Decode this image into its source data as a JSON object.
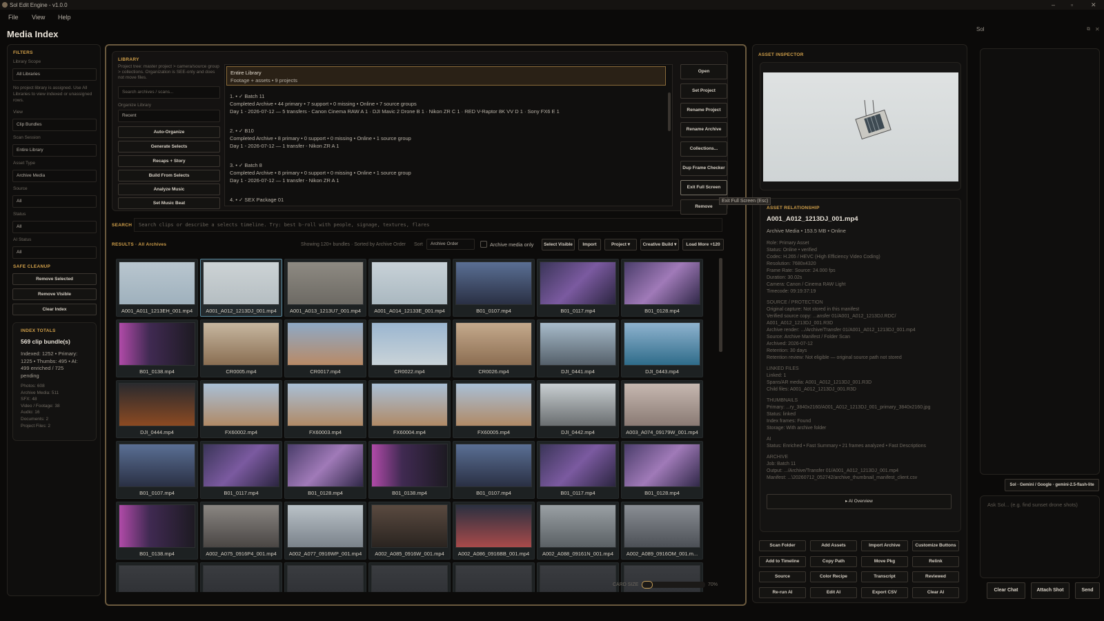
{
  "window": {
    "title": "Sol Edit Engine - v1.0.0"
  },
  "menu": [
    "File",
    "View",
    "Help"
  ],
  "page_title": "Media Index",
  "filters": {
    "header": "FILTERS",
    "library_scope_label": "Library Scope",
    "library_scope_value": "All Libraries",
    "note": "No project library is assigned. Use All Libraries to view indexed or unassigned rows.",
    "view_label": "View",
    "view_value": "Clip Bundles",
    "scan_label": "Scan Session",
    "scan_value": "Entire Library",
    "asset_label": "Asset Type",
    "asset_value": "Archive Media",
    "source_label": "Source",
    "source_value": "All",
    "status_label": "Status",
    "status_value": "All",
    "ai_label": "AI Status",
    "ai_value": "All"
  },
  "cleanup": {
    "header": "SAFE CLEANUP",
    "remove_selected": "Remove Selected",
    "remove_visible": "Remove Visible",
    "clear_index": "Clear Index"
  },
  "totals": {
    "header": "INDEX TOTALS",
    "count": "569 clip bundle(s)",
    "summary": [
      "Indexed: 1252 • Primary:",
      "1225 • Thumbs: 495 • AI:",
      "499 enriched / 725",
      "pending"
    ],
    "lines": [
      "Photos: 608",
      "Archive Media: 511",
      "SFX: 48",
      "Video / Footage: 38",
      "Audio: 16",
      "Documents: 2",
      "Project Files: 2"
    ]
  },
  "library": {
    "header": "LIBRARY",
    "desc": "Project tree: master project > camera/source group > collections. Organization is SEE-only and does not move files.",
    "search_placeholder": "Search archives / scans...",
    "organize_label": "Organize Library",
    "organize_value": "Recent",
    "actions": [
      "Auto-Organize",
      "Generate Selects",
      "Recaps + Story",
      "Build From Selects",
      "Analyze Music",
      "Set Music Beat"
    ],
    "entire": {
      "title": "Entire Library",
      "sub": "Footage + assets • 9 projects"
    },
    "items": [
      {
        "t": "1. • ✓ Batch 11",
        "a": "Completed Archive • 44 primary • 7 support • 0 missing • Online • 7 source groups",
        "b": "Day 1 - 2026-07-12 — 5 transfers - Canon Cinema RAW A 1 · DJI Mavic 2 Drone B 1 · Nikon ZR C 1 · RED V-Raptor 8K VV D 1 · Sony FX6 E 1"
      },
      {
        "t": "2. • ✓ B10",
        "a": "Completed Archive • 8 primary • 0 support • 0 missing • Online • 1 source group",
        "b": "Day 1 - 2026-07-12 — 1 transfer - Nikon ZR A 1"
      },
      {
        "t": "3. • ✓ Batch 8",
        "a": "Completed Archive • 8 primary • 0 support • 0 missing • Online • 1 source group",
        "b": "Day 1 - 2026-07-12 — 1 transfer - Nikon ZR A 1"
      },
      {
        "t": "4. • ✓ SEX Package 01",
        "a": "",
        "b": ""
      }
    ],
    "side": [
      "Open",
      "Set Project",
      "Rename Project",
      "Rename Archive",
      "Collections...",
      "Dup Frame Checker",
      "Exit Full Screen",
      "Remove"
    ],
    "tooltip": "Exit Full Screen (Esc)"
  },
  "search": {
    "label": "SEARCH",
    "placeholder": "Search clips or describe a selects timeline. Try: best b-roll with people, signage, textures, flares"
  },
  "results": {
    "label": "RESULTS · All Archives",
    "info": "Showing 120+ bundles · Sorted by Archive Order",
    "sort_label": "Sort",
    "sort_value": "Archive Order",
    "archive_only": "Archive media only",
    "buttons": [
      "Select Visible",
      "Import",
      "Project ▾",
      "Creative Build ▾",
      "Load More +120"
    ]
  },
  "grid": [
    "A001_A011_1213EH_001.mp4",
    "A001_A012_1213DJ_001.mp4",
    "A001_A013_1213U7_001.mp4",
    "A001_A014_12133E_001.mp4",
    "B01_0107.mp4",
    "B01_0117.mp4",
    "B01_0128.mp4",
    "B01_0138.mp4",
    "CR0005.mp4",
    "CR0017.mp4",
    "CR0022.mp4",
    "CR0026.mp4",
    "DJI_0441.mp4",
    "DJI_0443.mp4",
    "DJI_0444.mp4",
    "FX60002.mp4",
    "FX60003.mp4",
    "FX60004.mp4",
    "FX60005.mp4",
    "DJI_0442.mp4",
    "A003_A074_09179W_001.mp4",
    "B01_0107.mp4",
    "B01_0117.mp4",
    "B01_0128.mp4",
    "B01_0138.mp4",
    "B01_0107.mp4",
    "B01_0117.mp4",
    "B01_0128.mp4",
    "B01_0138.mp4",
    "A002_A075_0916P4_001.mp4",
    "A002_A077_0916WP_001.mp4",
    "A002_A085_0916W_001.mp4",
    "A002_A086_0916BB_001.mp4",
    "A002_A088_09161N_001.mp4",
    "A002_A089_0916OM_001.m..."
  ],
  "card_size": {
    "label": "CARD SIZE",
    "value": "70%",
    "level": 0.7
  },
  "inspector": {
    "header": "ASSET INSPECTOR",
    "rel_header": "ASSET RELATIONSHIP",
    "file": "A001_A012_1213DJ_001.mp4",
    "meta": "Archive Media • 153.5 MB • Online",
    "lines": [
      {
        "h": false,
        "t": "Role: Primary Asset"
      },
      {
        "h": false,
        "t": "Status: Online • verified"
      },
      {
        "h": false,
        "t": "Codec: H.265 / HEVC (High Efficiency Video Coding)"
      },
      {
        "h": false,
        "t": "Resolution: 7680x4320"
      },
      {
        "h": false,
        "t": "Frame Rate: Source: 24.000 fps"
      },
      {
        "h": false,
        "t": "Duration: 30.02s"
      },
      {
        "h": false,
        "t": "Camera: Canon / Cinema RAW Light"
      },
      {
        "h": false,
        "t": "Timecode: 09:19:37:19"
      },
      {
        "h": true,
        "t": "SOURCE / PROTECTION"
      },
      {
        "h": false,
        "t": "Original capture: Not stored in this manifest"
      },
      {
        "h": false,
        "t": "Verified source copy: ...ansfer 01/A001_A012_1213DJ.RDC/"
      },
      {
        "h": false,
        "t": "A001_A012_1213DJ_001.R3D"
      },
      {
        "h": false,
        "t": "Archive render: .../Archive/Transfer 01/A001_A012_1213DJ_001.mp4"
      },
      {
        "h": false,
        "t": "Source: Archive Manifest / Folder Scan"
      },
      {
        "h": false,
        "t": "Archived: 2026-07-12"
      },
      {
        "h": false,
        "t": "Retention: 30 days"
      },
      {
        "h": false,
        "t": "Retention review: Not eligible — original source path not stored"
      },
      {
        "h": true,
        "t": "LINKED FILES"
      },
      {
        "h": false,
        "t": "Linked: 1"
      },
      {
        "h": false,
        "t": "Spans/AR media: A001_A012_1213DJ_001.R3D"
      },
      {
        "h": false,
        "t": "Child files: A001_A012_1213DJ_001.R3D"
      },
      {
        "h": true,
        "t": "THUMBNAILS"
      },
      {
        "h": false,
        "t": "Primary: ...ry_3840x2160/A001_A012_1213DJ_001_primary_3840x2160.jpg"
      },
      {
        "h": false,
        "t": "Status: linked"
      },
      {
        "h": false,
        "t": "Index frames: Found"
      },
      {
        "h": false,
        "t": "Storage: With archive folder"
      },
      {
        "h": true,
        "t": "AI"
      },
      {
        "h": false,
        "t": "Status: Enriched • Fast Summary • 21 frames analyzed • Fast Descriptions"
      },
      {
        "h": true,
        "t": "ARCHIVE"
      },
      {
        "h": false,
        "t": "Job: Batch 11"
      },
      {
        "h": false,
        "t": "Output: .../Archive/Transfer 01/A001_A012_1213DJ_001.mp4"
      },
      {
        "h": false,
        "t": "Manifest: ...\\20260712_052742/archive_thumbnail_manifest_client.csv"
      }
    ],
    "ai_overview": "▸ AI Overview",
    "actions": [
      "Scan Folder",
      "Add Assets",
      "Import Archive",
      "Customize Buttons",
      "Add to Timeline",
      "Copy Path",
      "Move Pkg",
      "Relink",
      "Source",
      "Color Recipe",
      "Transcript",
      "Reviewed",
      "Re-run AI",
      "Edit AI",
      "Export CSV",
      "Clear AI"
    ]
  },
  "sol": {
    "title": "Sol",
    "model": "Sol · Gemini / Google · gemini-2.5-flash-lite",
    "placeholder": "Ask Sol... (e.g. find sunset drone shots)",
    "clear": "Clear Chat",
    "attach": "Attach Shot",
    "send": "Send"
  }
}
